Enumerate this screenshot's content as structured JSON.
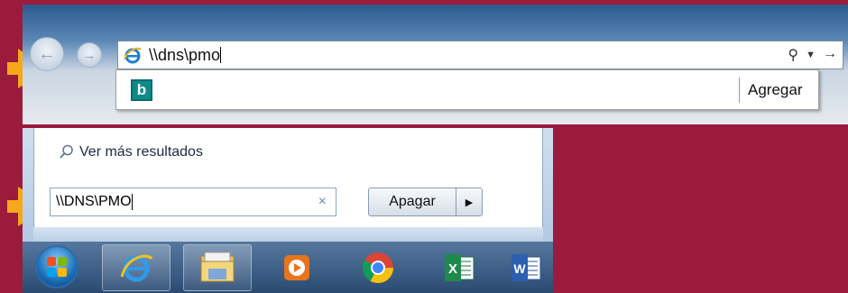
{
  "browser": {
    "address": "\\\\dns\\pmo",
    "suggestion_action": "Agregar"
  },
  "start_menu": {
    "see_more": "Ver más resultados",
    "search_value": "\\\\DNS\\PMO",
    "shutdown_label": "Apagar"
  },
  "taskbar": {
    "items": [
      "start-orb",
      "internet-explorer-icon",
      "file-explorer-icon",
      "media-player-icon",
      "chrome-icon",
      "excel-icon",
      "word-icon"
    ]
  },
  "colors": {
    "background": "#9b1b3c",
    "arrow": "#f5a81a",
    "bing": "#0e8a8a"
  }
}
